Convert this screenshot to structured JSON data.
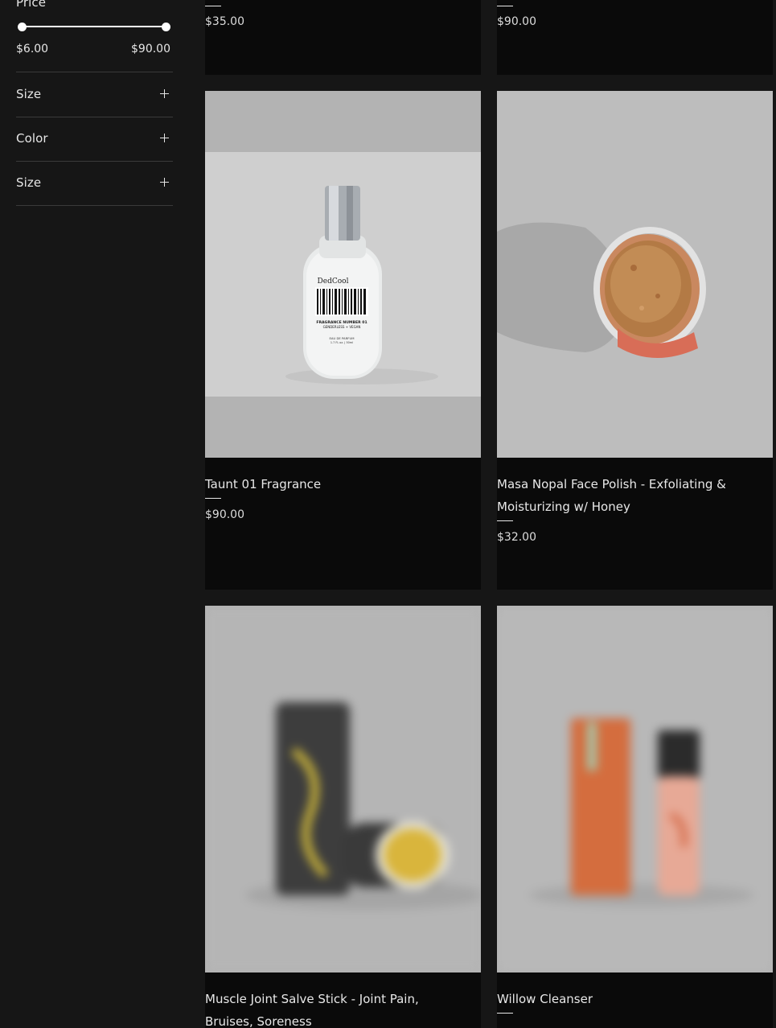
{
  "filters": {
    "price": {
      "title": "Price",
      "min_label": "$6.00",
      "max_label": "$90.00",
      "range_fraction": [
        0.0,
        1.0
      ]
    },
    "size_1": {
      "title": "Size"
    },
    "color": {
      "title": "Color"
    },
    "size_2": {
      "title": "Size"
    }
  },
  "products": {
    "top_left": {
      "price": "$35.00"
    },
    "top_right": {
      "price": "$90.00"
    },
    "taunt": {
      "name": "Taunt 01 Fragrance",
      "price": "$90.00",
      "label_brand": "DedCool",
      "label_line1": "FRAGRANCE NUMBER 01",
      "label_line2": "GENDERLESS + VEGAN",
      "label_line3": "EAU DE PARFUM",
      "label_line4": "1.7 FL oz. | 50ml"
    },
    "masa": {
      "name": "Masa Nopal Face Polish - Exfoliating & Moisturizing w/ Honey",
      "price": "$32.00"
    },
    "salve": {
      "name": "Muscle Joint Salve Stick - Joint Pain, Bruises, Soreness"
    },
    "willow": {
      "name": "Willow Cleanser"
    }
  },
  "colors": {
    "background": "#161616",
    "card_background": "#0a0a0a",
    "image_background": "#b3b3b3",
    "text": "#e8e8e8"
  }
}
